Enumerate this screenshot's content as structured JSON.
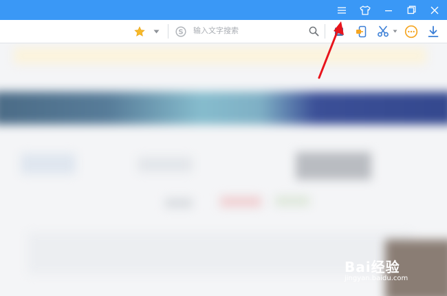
{
  "titlebar": {
    "color": "#3a98f6",
    "buttons": [
      {
        "icon": "menu-icon"
      },
      {
        "icon": "skin-shirt-icon"
      },
      {
        "icon": "minimize-icon"
      },
      {
        "icon": "restore-icon"
      },
      {
        "icon": "close-icon"
      }
    ]
  },
  "toolbar": {
    "favorites_icon": "star-icon",
    "favorites_dropdown_icon": "chevron-down-icon",
    "search_engine_icon": "sogou-s-icon",
    "search_placeholder": "输入文字搜索",
    "search_button_icon": "search-icon",
    "extensions": [
      {
        "icon": "app-grid-icon"
      },
      {
        "icon": "phone-transfer-icon"
      },
      {
        "icon": "scissors-icon"
      },
      {
        "icon": "more-dots-icon"
      },
      {
        "icon": "download-icon"
      }
    ]
  },
  "annotation": {
    "arrow_color": "#e8141c"
  },
  "watermark": {
    "logo_text": "Bai经验",
    "url": "jingyan.baidu.com"
  }
}
